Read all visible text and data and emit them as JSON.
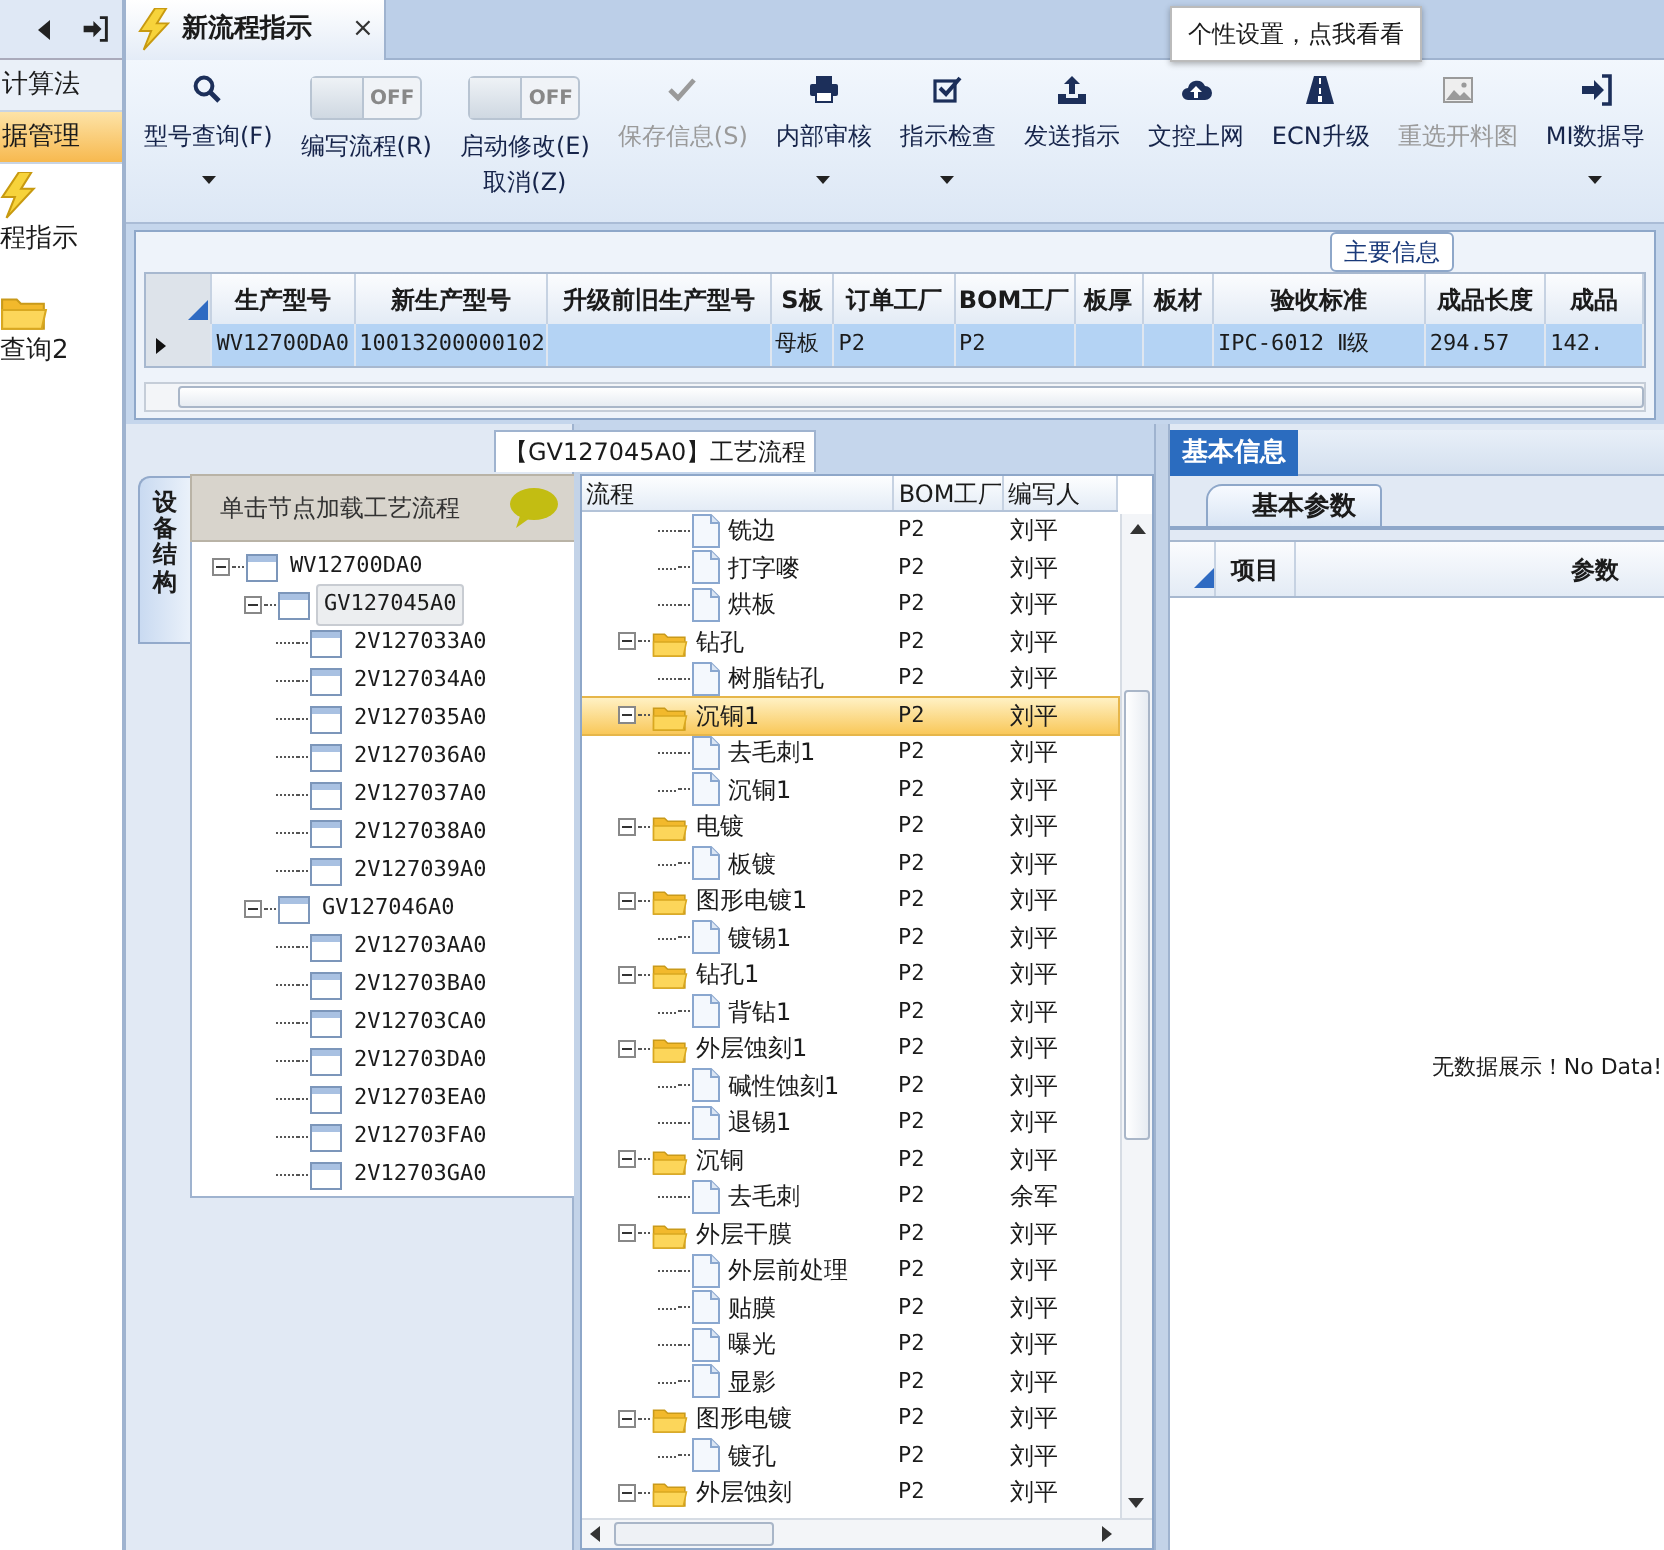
{
  "sidebar": {
    "items": [
      {
        "kind": "text",
        "label": "计算法",
        "selected": false
      },
      {
        "kind": "text",
        "label": "据管理",
        "selected": true
      },
      {
        "kind": "lightning",
        "label": "程指示",
        "selected": false
      },
      {
        "kind": "folder",
        "label": "查询2",
        "selected": false
      }
    ]
  },
  "tabs": [
    {
      "label": "新流程指示",
      "selected": true,
      "closable": true,
      "close": "×"
    }
  ],
  "tooltip": "个性设置，点我看看",
  "toolbar": [
    {
      "kind": "button",
      "lines": [
        "型号查询(F)"
      ],
      "disabled": false,
      "dropdown": true
    },
    {
      "kind": "toggle",
      "switch_text": "OFF",
      "on": false,
      "lines": [
        "编写流程(R)"
      ]
    },
    {
      "kind": "toggle",
      "switch_text": "OFF",
      "on": false,
      "lines": [
        "启动修改(E)",
        "取消(Z)"
      ]
    },
    {
      "kind": "button",
      "lines": [
        "保存信息(S)"
      ],
      "disabled": true,
      "dropdown": false
    },
    {
      "kind": "button",
      "lines": [
        "内部审核"
      ],
      "disabled": false,
      "dropdown": true
    },
    {
      "kind": "button",
      "lines": [
        "指示检查"
      ],
      "disabled": false,
      "dropdown": true
    },
    {
      "kind": "button",
      "lines": [
        "发送指示"
      ],
      "disabled": false,
      "dropdown": false
    },
    {
      "kind": "button",
      "lines": [
        "文控上网"
      ],
      "disabled": false,
      "dropdown": false
    },
    {
      "kind": "button",
      "lines": [
        "ECN升级"
      ],
      "disabled": false,
      "dropdown": false
    },
    {
      "kind": "button",
      "lines": [
        "重选开料图"
      ],
      "disabled": true,
      "dropdown": false
    },
    {
      "kind": "button",
      "lines": [
        "MI数据导"
      ],
      "disabled": false,
      "dropdown": true
    }
  ],
  "main_info": {
    "title": "主要信息",
    "columns": [
      "生产型号",
      "新生产型号",
      "升级前旧生产型号",
      "S板",
      "订单工厂",
      "BOM工厂",
      "板厚",
      "板材",
      "验收标准",
      "成品长度",
      "成品"
    ],
    "rows": [
      {
        "selected": true,
        "cells": [
          "WV12700DA0",
          "10013200000102",
          null,
          "母板",
          "P2",
          "P2",
          null,
          null,
          "IPC-6012 Ⅱ级",
          "294.57",
          "142."
        ]
      }
    ]
  },
  "process": {
    "title": "【GV127045A0】工艺流程",
    "side_tab": "设备结构",
    "hint": "单击节点加载工艺流程",
    "tree": [
      {
        "label": "WV12700DA0",
        "expanded": true,
        "selected": false,
        "children": [
          {
            "label": "GV127045A0",
            "expanded": true,
            "selected": true,
            "children": [
              {
                "label": "2V127033A0",
                "selected": false
              },
              {
                "label": "2V127034A0",
                "selected": false
              },
              {
                "label": "2V127035A0",
                "selected": false
              },
              {
                "label": "2V127036A0",
                "selected": false
              },
              {
                "label": "2V127037A0",
                "selected": false
              },
              {
                "label": "2V127038A0",
                "selected": false
              },
              {
                "label": "2V127039A0",
                "selected": false
              }
            ]
          },
          {
            "label": "GV127046A0",
            "expanded": true,
            "selected": false,
            "children": [
              {
                "label": "2V12703AA0",
                "selected": false
              },
              {
                "label": "2V12703BA0",
                "selected": false
              },
              {
                "label": "2V12703CA0",
                "selected": false
              },
              {
                "label": "2V12703DA0",
                "selected": false
              },
              {
                "label": "2V12703EA0",
                "selected": false
              },
              {
                "label": "2V12703FA0",
                "selected": false
              },
              {
                "label": "2V12703GA0",
                "selected": false
              }
            ]
          }
        ]
      }
    ]
  },
  "flow": {
    "columns": [
      "流程",
      "BOM工厂",
      "编写人"
    ],
    "rows": [
      {
        "kind": "group",
        "children": [
          {
            "kind": "step",
            "name": "铣边",
            "bom": "P2",
            "author": "刘平",
            "selected": false
          },
          {
            "kind": "step",
            "name": "打字嘜",
            "bom": "P2",
            "author": "刘平",
            "selected": false
          },
          {
            "kind": "step",
            "name": "烘板",
            "bom": "P2",
            "author": "刘平",
            "selected": false
          }
        ]
      },
      {
        "kind": "group",
        "name": "钻孔",
        "bom": "P2",
        "author": "刘平",
        "expanded": true,
        "selected": false,
        "children": [
          {
            "kind": "step",
            "name": "树脂钻孔",
            "bom": "P2",
            "author": "刘平",
            "selected": false
          }
        ]
      },
      {
        "kind": "group",
        "name": "沉铜1",
        "bom": "P2",
        "author": "刘平",
        "expanded": true,
        "selected": true,
        "children": [
          {
            "kind": "step",
            "name": "去毛刺1",
            "bom": "P2",
            "author": "刘平",
            "selected": false
          },
          {
            "kind": "step",
            "name": "沉铜1",
            "bom": "P2",
            "author": "刘平",
            "selected": false
          }
        ]
      },
      {
        "kind": "group",
        "name": "电镀",
        "bom": "P2",
        "author": "刘平",
        "expanded": true,
        "selected": false,
        "children": [
          {
            "kind": "step",
            "name": "板镀",
            "bom": "P2",
            "author": "刘平",
            "selected": false
          }
        ]
      },
      {
        "kind": "group",
        "name": "图形电镀1",
        "bom": "P2",
        "author": "刘平",
        "expanded": true,
        "selected": false,
        "children": [
          {
            "kind": "step",
            "name": "镀锡1",
            "bom": "P2",
            "author": "刘平",
            "selected": false
          }
        ]
      },
      {
        "kind": "group",
        "name": "钻孔1",
        "bom": "P2",
        "author": "刘平",
        "expanded": true,
        "selected": false,
        "children": [
          {
            "kind": "step",
            "name": "背钻1",
            "bom": "P2",
            "author": "刘平",
            "selected": false
          }
        ]
      },
      {
        "kind": "group",
        "name": "外层蚀刻1",
        "bom": "P2",
        "author": "刘平",
        "expanded": true,
        "selected": false,
        "children": [
          {
            "kind": "step",
            "name": "碱性蚀刻1",
            "bom": "P2",
            "author": "刘平",
            "selected": false
          },
          {
            "kind": "step",
            "name": "退锡1",
            "bom": "P2",
            "author": "刘平",
            "selected": false
          }
        ]
      },
      {
        "kind": "group",
        "name": "沉铜",
        "bom": "P2",
        "author": "刘平",
        "expanded": true,
        "selected": false,
        "children": [
          {
            "kind": "step",
            "name": "去毛刺",
            "bom": "P2",
            "author": "余军",
            "selected": false
          }
        ]
      },
      {
        "kind": "group",
        "name": "外层干膜",
        "bom": "P2",
        "author": "刘平",
        "expanded": true,
        "selected": false,
        "children": [
          {
            "kind": "step",
            "name": "外层前处理",
            "bom": "P2",
            "author": "刘平",
            "selected": false
          },
          {
            "kind": "step",
            "name": "贴膜",
            "bom": "P2",
            "author": "刘平",
            "selected": false
          },
          {
            "kind": "step",
            "name": "曝光",
            "bom": "P2",
            "author": "刘平",
            "selected": false
          },
          {
            "kind": "step",
            "name": "显影",
            "bom": "P2",
            "author": "刘平",
            "selected": false
          }
        ]
      },
      {
        "kind": "group",
        "name": "图形电镀",
        "bom": "P2",
        "author": "刘平",
        "expanded": true,
        "selected": false,
        "children": [
          {
            "kind": "step",
            "name": "镀孔",
            "bom": "P2",
            "author": "刘平",
            "selected": false
          }
        ]
      },
      {
        "kind": "group",
        "name": "外层蚀刻",
        "bom": "P2",
        "author": "刘平",
        "expanded": true,
        "selected": false
      }
    ]
  },
  "details": {
    "tab": "基本信息",
    "sub_tab": "基本参数",
    "columns": [
      "项目",
      "参数"
    ],
    "empty_text": "无数据展示！No Data!"
  }
}
